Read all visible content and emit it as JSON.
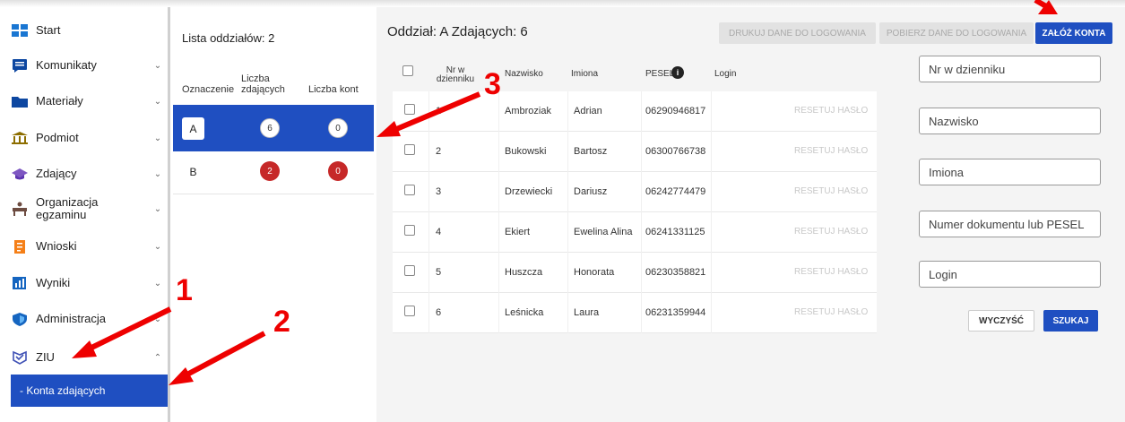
{
  "sidebar": {
    "items": [
      {
        "label": "Start",
        "icon": "dashboard-icon"
      },
      {
        "label": "Komunikaty",
        "icon": "message-icon"
      },
      {
        "label": "Materiały",
        "icon": "folder-icon"
      },
      {
        "label": "Podmiot",
        "icon": "institution-icon"
      },
      {
        "label": "Zdający",
        "icon": "graduation-cap-icon"
      },
      {
        "label": "Organizacja egzaminu",
        "icon": "desk-icon"
      },
      {
        "label": "Wnioski",
        "icon": "clipboard-icon"
      },
      {
        "label": "Wyniki",
        "icon": "bar-chart-icon"
      },
      {
        "label": "Administracja",
        "icon": "shield-icon"
      },
      {
        "label": "ZIU",
        "icon": "ziu-icon"
      }
    ],
    "sub_item": "- Konta zdających"
  },
  "classes": {
    "title": "Lista oddziałów: 2",
    "col_symbol": "Oznaczenie",
    "col_count": "Liczba zdających",
    "col_accounts": "Liczba kont",
    "rows": [
      {
        "symbol": "A",
        "count": "6",
        "accounts": "0"
      },
      {
        "symbol": "B",
        "count": "2",
        "accounts": "0"
      }
    ]
  },
  "main": {
    "title": "Oddział: A Zdających: 6",
    "btn_print": "DRUKUJ DANE DO LOGOWANIA",
    "btn_download": "POBIERZ DANE DO LOGOWANIA",
    "btn_create": "ZAŁÓŻ KONTA",
    "headers": {
      "nr": "Nr w dzienniku",
      "surname": "Nazwisko",
      "names": "Imiona",
      "pesel": "PESEL",
      "login": "Login"
    },
    "reset_label": "RESETUJ HASŁO",
    "rows": [
      {
        "nr": "1",
        "surname": "Ambroziak",
        "names": "Adrian",
        "pesel": "06290946817"
      },
      {
        "nr": "2",
        "surname": "Bukowski",
        "names": "Bartosz",
        "pesel": "06300766738"
      },
      {
        "nr": "3",
        "surname": "Drzewiecki",
        "names": "Dariusz",
        "pesel": "06242774479"
      },
      {
        "nr": "4",
        "surname": "Ekiert",
        "names": "Ewelina Alina",
        "pesel": "06241331125"
      },
      {
        "nr": "5",
        "surname": "Huszcza",
        "names": "Honorata",
        "pesel": "06230358821"
      },
      {
        "nr": "6",
        "surname": "Leśnicka",
        "names": "Laura",
        "pesel": "06231359944"
      }
    ]
  },
  "filters": {
    "nr": "Nr w dzienniku",
    "surname": "Nazwisko",
    "names": "Imiona",
    "document": "Numer dokumentu lub PESEL",
    "login": "Login",
    "clear": "WYCZYŚĆ",
    "search": "SZUKAJ"
  },
  "annotations": [
    "1",
    "2",
    "3"
  ],
  "colors": {
    "primary": "#1f4fc1",
    "badge_red": "#c62828",
    "annotation": "#e00000"
  }
}
